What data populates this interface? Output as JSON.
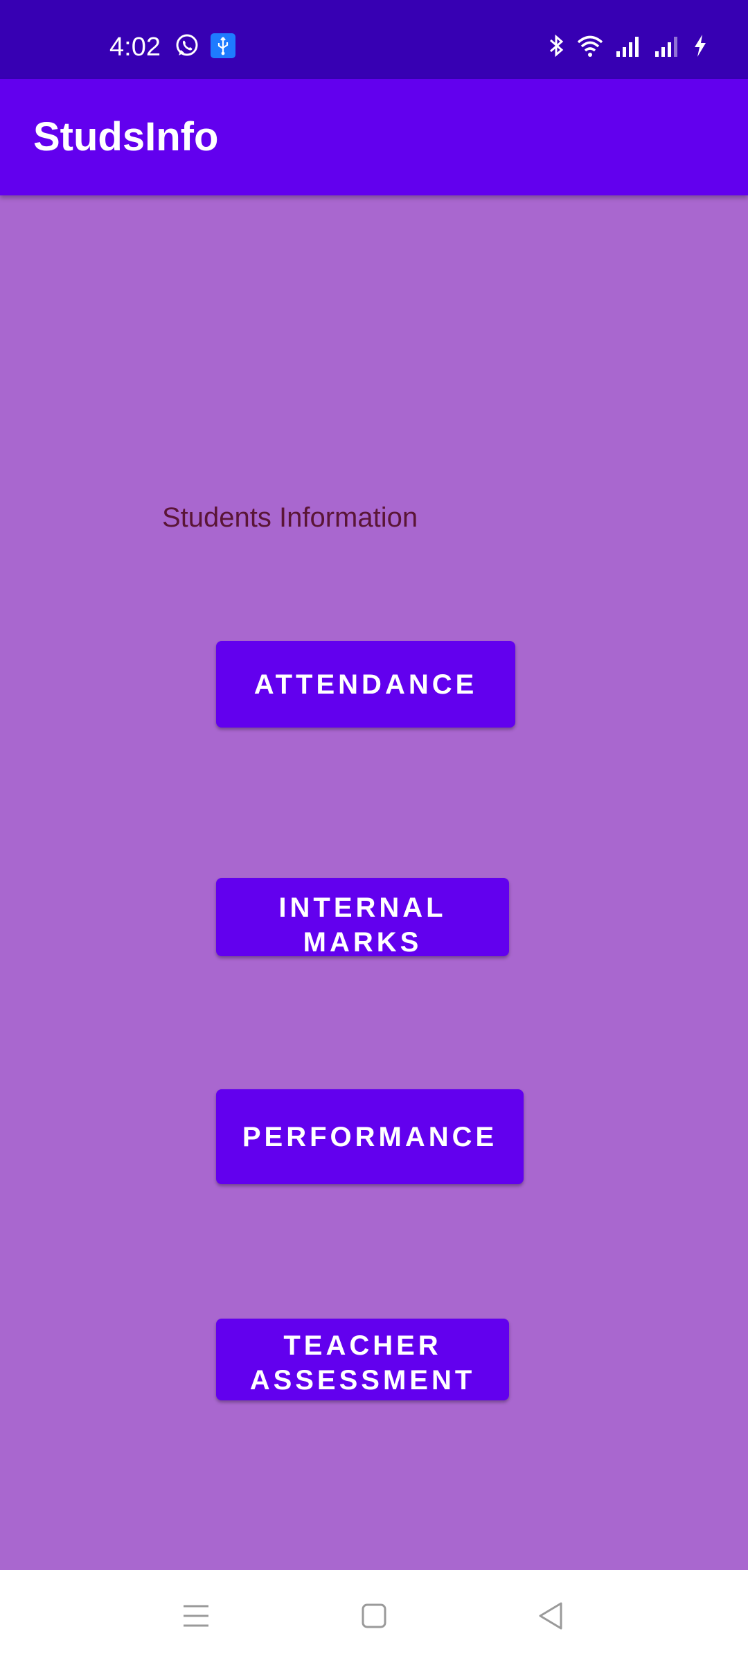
{
  "status_bar": {
    "time": "4:02",
    "left_icons": [
      "whatsapp-icon",
      "usb-debug-icon"
    ],
    "right_icons": [
      "bluetooth-icon",
      "wifi-icon",
      "signal-icon",
      "signal-icon-2",
      "charging-icon"
    ]
  },
  "app_bar": {
    "title": "StudsInfo"
  },
  "main": {
    "heading": "Students Information",
    "buttons": {
      "attendance": "ATTENDANCE",
      "internal_marks": "INTERNAL MARKS",
      "performance": "PERFORMANCE",
      "teacher_assessment": "TEACHER ASSESSMENT"
    }
  },
  "nav_bar": {
    "icons": [
      "menu-icon",
      "home-icon",
      "back-icon"
    ]
  },
  "colors": {
    "status_bar": "#3700b3",
    "app_bar": "#6200ee",
    "background": "#a967cf",
    "button": "#6200ee",
    "heading_text": "#5a1536"
  }
}
